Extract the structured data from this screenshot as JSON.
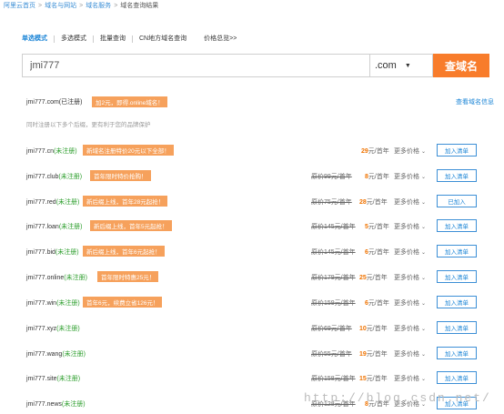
{
  "breadcrumb": {
    "items": [
      "阿里云首页",
      "域名与网站",
      "域名服务"
    ],
    "current": "域名查询结果"
  },
  "tabs": [
    {
      "label": "单选模式"
    },
    {
      "label": "多选模式"
    },
    {
      "label": "批量查询"
    },
    {
      "label": "CN地方域名查询"
    },
    {
      "label": "价格总览>>"
    }
  ],
  "search": {
    "value": "jmi777",
    "suffix": ".com",
    "button_label": "查域名"
  },
  "primary": {
    "domain": "jmi777.com(已注册)",
    "promo": "加2元，即得.online域名！",
    "whois_label": "查看域名信息"
  },
  "hint": "同时注册以下多个后缀，更有利于您的品牌保护",
  "results": [
    {
      "name": "jmi777.cn",
      "status": "(未注册)",
      "promo": "新域名注册特价20元以下全部！",
      "orig": "",
      "price": "29",
      "unit": "元/首年",
      "more": "更多价格",
      "button": "加入清单"
    },
    {
      "name": "jmi777.club",
      "status": "(未注册)",
      "promo": "首年限时特价抢购！",
      "orig": "原价99元/首年",
      "price": "8",
      "unit": "元/首年",
      "more": "更多价格",
      "button": "加入清单"
    },
    {
      "name": "jmi777.red",
      "status": "(未注册)",
      "promo": "新后缀上线，首年28元起抢！",
      "orig": "原价75元/首年",
      "price": "28",
      "unit": "元/首年",
      "more": "更多价格",
      "button": "已加入"
    },
    {
      "name": "jmi777.loan",
      "status": "(未注册)",
      "promo": "新后缀上线，首年5元起抢！",
      "orig": "原价145元/首年",
      "price": "5",
      "unit": "元/首年",
      "more": "更多价格",
      "button": "加入清单"
    },
    {
      "name": "jmi777.bid",
      "status": "(未注册)",
      "promo": "新后缀上线，首年6元起抢！",
      "orig": "原价145元/首年",
      "price": "6",
      "unit": "元/首年",
      "more": "更多价格",
      "button": "加入清单"
    },
    {
      "name": "jmi777.online",
      "status": "(未注册)",
      "promo": "首年限时特惠25元！",
      "orig": "原价179元/首年",
      "price": "25",
      "unit": "元/首年",
      "more": "更多价格",
      "button": "加入清单"
    },
    {
      "name": "jmi777.win",
      "status": "(未注册)",
      "promo": "首年6元，续费立省126元！",
      "orig": "原价159元/首年",
      "price": "6",
      "unit": "元/首年",
      "more": "更多价格",
      "button": "加入清单"
    },
    {
      "name": "jmi777.xyz",
      "status": "(未注册)",
      "promo": "",
      "orig": "原价69元/首年",
      "price": "10",
      "unit": "元/首年",
      "more": "更多价格",
      "button": "加入清单"
    },
    {
      "name": "jmi777.wang",
      "status": "(未注册)",
      "promo": "",
      "orig": "原价55元/首年",
      "price": "19",
      "unit": "元/首年",
      "more": "更多价格",
      "button": "加入清单"
    },
    {
      "name": "jmi777.site",
      "status": "(未注册)",
      "promo": "",
      "orig": "原价158元/首年",
      "price": "15",
      "unit": "元/首年",
      "more": "更多价格",
      "button": "加入清单"
    },
    {
      "name": "jmi777.news",
      "status": "(未注册)",
      "promo": "",
      "orig": "原价128元/首年",
      "price": "8",
      "unit": "元/首年",
      "more": "更多价格",
      "button": "加入清单"
    }
  ],
  "watermark": "http://blog.csdn.net/",
  "colors": {
    "accent": "#f87c2b",
    "link": "#1a84d6",
    "status": "#2a9d2a",
    "price": "#f07300"
  }
}
